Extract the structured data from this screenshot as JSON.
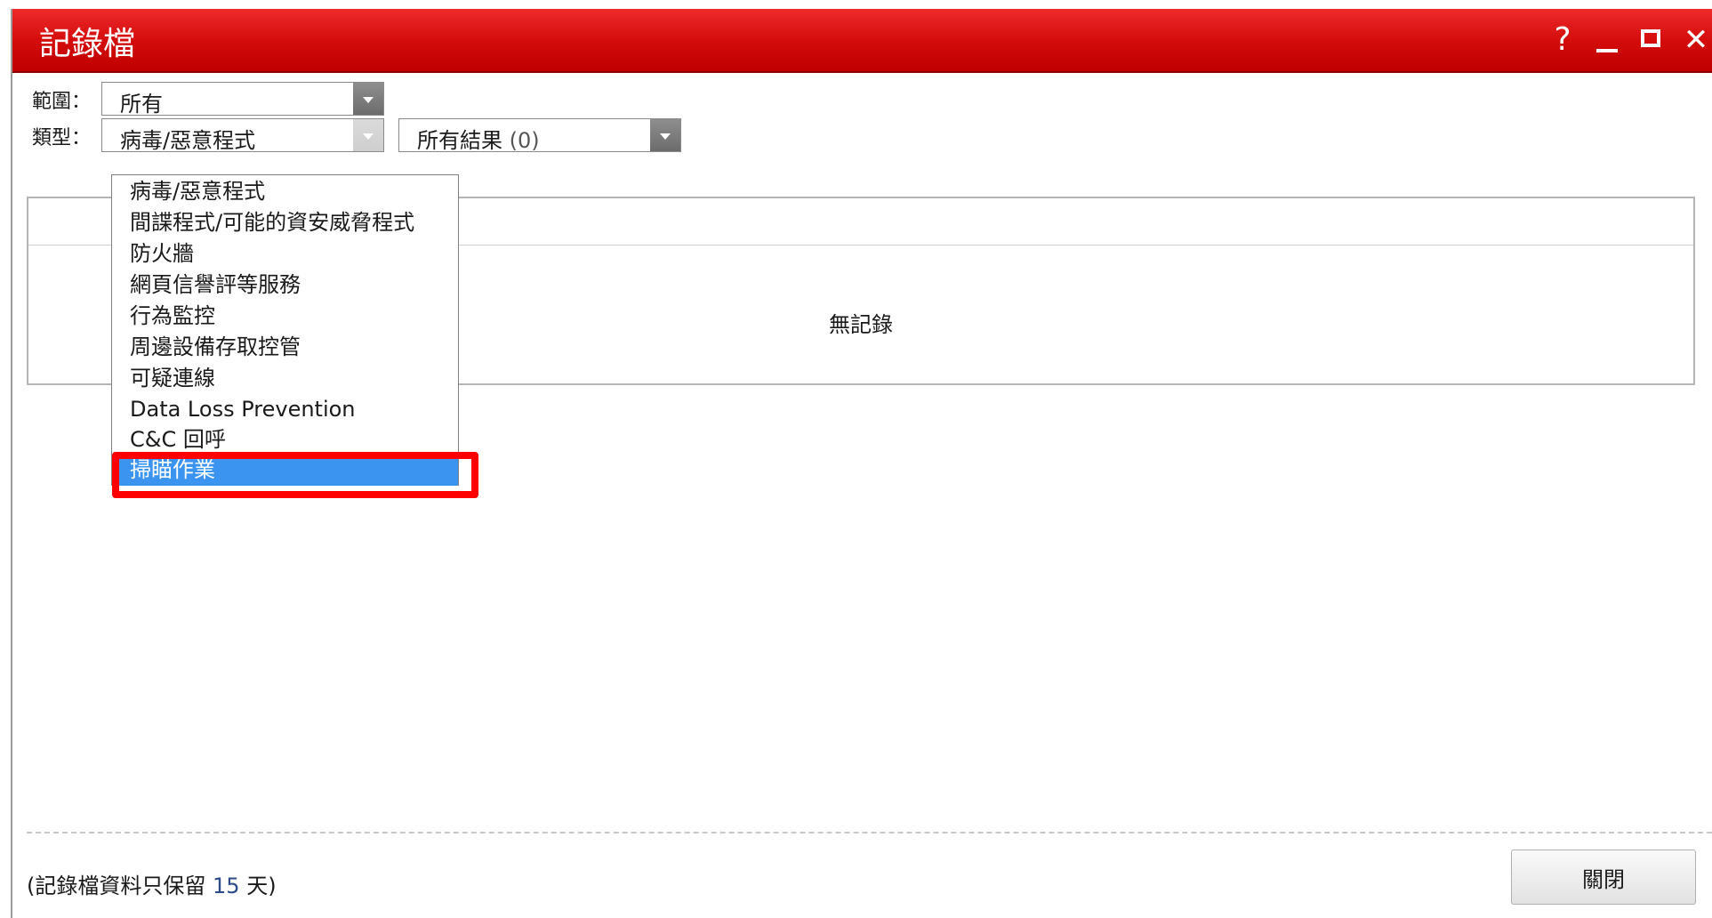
{
  "window": {
    "title": "記錄檔",
    "controls": {
      "help": "?",
      "close": "✕"
    }
  },
  "filters": {
    "scope_label": "範圍：",
    "scope_value": "所有",
    "type_label": "類型：",
    "type_value": "病毒/惡意程式",
    "result_value": "所有結果",
    "result_count": "(0)"
  },
  "dropdown": {
    "options": [
      "病毒/惡意程式",
      "間諜程式/可能的資安威脅程式",
      "防火牆",
      "網頁信譽評等服務",
      "行為監控",
      "周邊設備存取控管",
      "可疑連線",
      "Data Loss Prevention",
      "C&C 回呼",
      "掃瞄作業"
    ],
    "selected": "掃瞄作業"
  },
  "table": {
    "empty_text": "無記錄"
  },
  "footer": {
    "retention_prefix": "(記錄檔資料只保留",
    "retention_days": "15",
    "retention_suffix": "天)",
    "close_button": "關閉"
  },
  "colors": {
    "titlebar": "#d20a0a",
    "selected_option": "#3b94f0",
    "highlight_box": "#ff0000"
  }
}
